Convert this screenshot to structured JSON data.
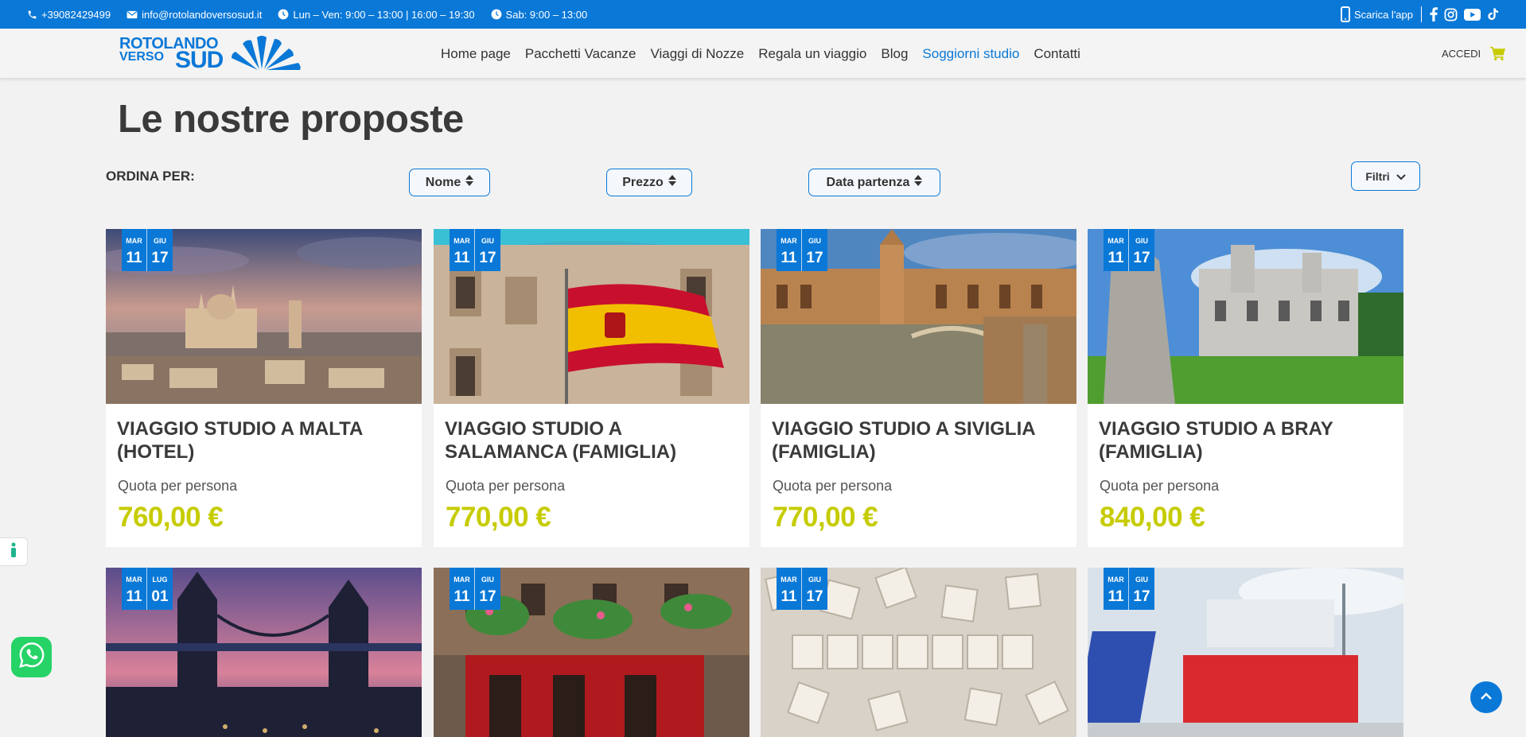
{
  "topbar": {
    "phone": "+39082429499",
    "email": "info@rotolandoversosud.it",
    "hours_weekdays": "Lun – Ven: 9:00 – 13:00 | 16:00 – 19:30",
    "hours_saturday": "Sab: 9:00 – 13:00",
    "app_label": "Scarica l'app",
    "social_icons": [
      "facebook-icon",
      "instagram-icon",
      "youtube-icon",
      "tiktok-icon"
    ]
  },
  "header": {
    "logo_line1": "ROTOLANDO",
    "logo_line2": "VERSO",
    "logo_line3": "SUD",
    "nav": [
      {
        "label": "Home page",
        "active": false
      },
      {
        "label": "Pacchetti Vacanze",
        "active": false
      },
      {
        "label": "Viaggi di Nozze",
        "active": false
      },
      {
        "label": "Regala un viaggio",
        "active": false
      },
      {
        "label": "Blog",
        "active": false
      },
      {
        "label": "Soggiorni studio",
        "active": true
      },
      {
        "label": "Contatti",
        "active": false
      }
    ],
    "login_label": "ACCEDI"
  },
  "main": {
    "title": "Le nostre proposte",
    "sort_label": "ORDINA PER:",
    "sort_options": [
      "Nome",
      "Prezzo",
      "Data partenza"
    ],
    "filter_label": "Filtri"
  },
  "cards": [
    {
      "month1": "MAR",
      "day1": "11",
      "month2": "GIU",
      "day2": "17",
      "title": "VIAGGIO STUDIO A MALTA (HOTEL)",
      "quota": "Quota per persona",
      "price": "760,00 €"
    },
    {
      "month1": "MAR",
      "day1": "11",
      "month2": "GIU",
      "day2": "17",
      "title": "VIAGGIO STUDIO A SALAMANCA (FAMIGLIA)",
      "quota": "Quota per persona",
      "price": "770,00 €"
    },
    {
      "month1": "MAR",
      "day1": "11",
      "month2": "GIU",
      "day2": "17",
      "title": "VIAGGIO STUDIO A SIVIGLIA (FAMIGLIA)",
      "quota": "Quota per persona",
      "price": "770,00 €"
    },
    {
      "month1": "MAR",
      "day1": "11",
      "month2": "GIU",
      "day2": "17",
      "title": "VIAGGIO STUDIO A BRAY (FAMIGLIA)",
      "quota": "Quota per persona",
      "price": "840,00 €"
    },
    {
      "month1": "MAR",
      "day1": "11",
      "month2": "LUG",
      "day2": "01"
    },
    {
      "month1": "MAR",
      "day1": "11",
      "month2": "GIU",
      "day2": "17"
    },
    {
      "month1": "MAR",
      "day1": "11",
      "month2": "GIU",
      "day2": "17"
    },
    {
      "month1": "MAR",
      "day1": "11",
      "month2": "GIU",
      "day2": "17"
    }
  ],
  "colors": {
    "brand_blue": "#0a78d7",
    "price_yellow": "#c6cc00",
    "whatsapp_green": "#25d366"
  }
}
